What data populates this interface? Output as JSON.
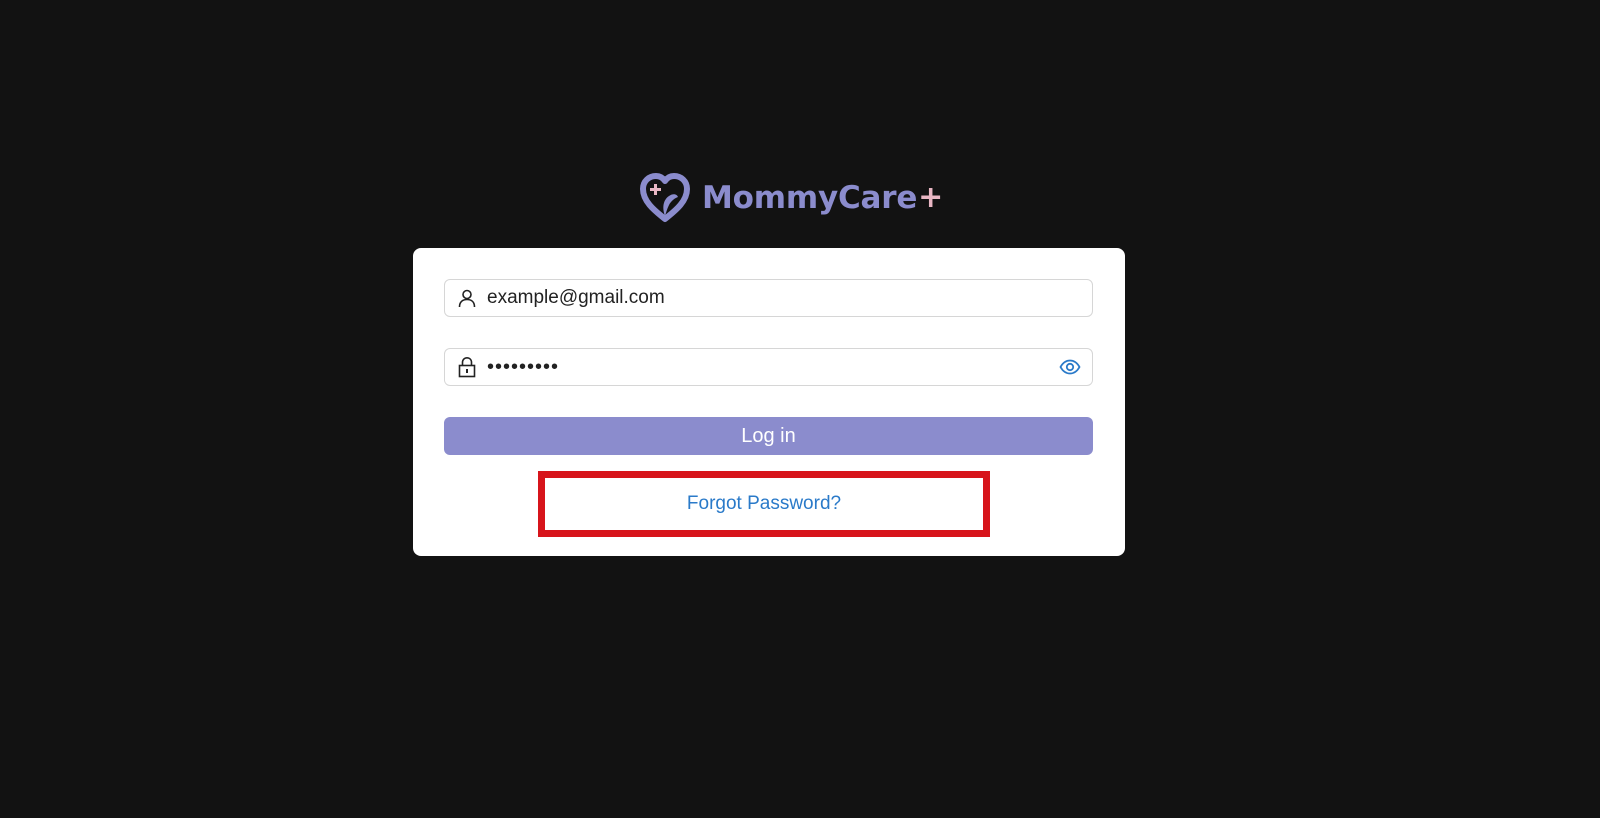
{
  "brand": {
    "name": "MommyCare",
    "suffix": "+",
    "logo_icon": "heart-hands-plus-icon",
    "colors": {
      "primary": "#8b8ccd",
      "accent": "#e9b7c4"
    }
  },
  "login_form": {
    "email": {
      "value": "example@gmail.com",
      "icon": "user-icon"
    },
    "password": {
      "value": "•••••••••",
      "icon": "lock-icon",
      "toggle_icon": "eye-icon"
    },
    "login_label": "Log in",
    "forgot_label": "Forgot Password?"
  },
  "colors": {
    "background": "#121212",
    "card": "#ffffff",
    "button": "#8b8ccd",
    "link": "#2a7ac9",
    "highlight": "#d7141b"
  }
}
